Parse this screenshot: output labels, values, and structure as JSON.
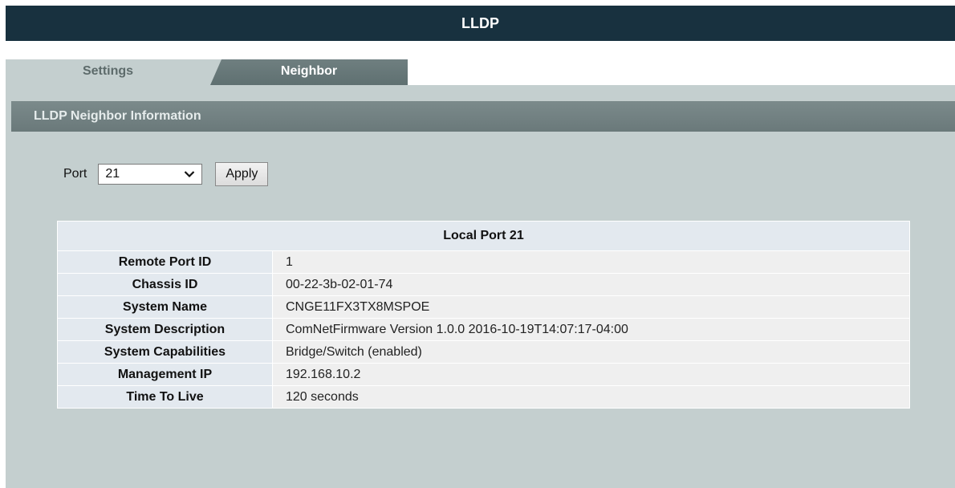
{
  "header": {
    "title": "LLDP"
  },
  "tabs": [
    {
      "label": "Settings",
      "active": false
    },
    {
      "label": "Neighbor",
      "active": true
    }
  ],
  "section": {
    "title": "LLDP Neighbor Information"
  },
  "port_selector": {
    "label": "Port",
    "selected": "21",
    "apply_label": "Apply"
  },
  "table": {
    "title": "Local Port 21",
    "rows": [
      {
        "label": "Remote Port ID",
        "value": "1"
      },
      {
        "label": "Chassis ID",
        "value": "00-22-3b-02-01-74"
      },
      {
        "label": "System Name",
        "value": "CNGE11FX3TX8MSPOE"
      },
      {
        "label": "System Description",
        "value": "ComNetFirmware Version 1.0.0 2016-10-19T14:07:17-04:00"
      },
      {
        "label": "System Capabilities",
        "value": "Bridge/Switch (enabled)"
      },
      {
        "label": "Management IP",
        "value": "192.168.10.2"
      },
      {
        "label": "Time To Live",
        "value": "120 seconds"
      }
    ]
  },
  "colors": {
    "title_bar": "#18313f",
    "panel": "#c4cfcf",
    "section_header": "#6f7e7f",
    "table_label_bg": "#e3e9ef",
    "table_value_bg": "#efefef"
  },
  "icons": {
    "select_arrow": "chevron-down-icon"
  }
}
